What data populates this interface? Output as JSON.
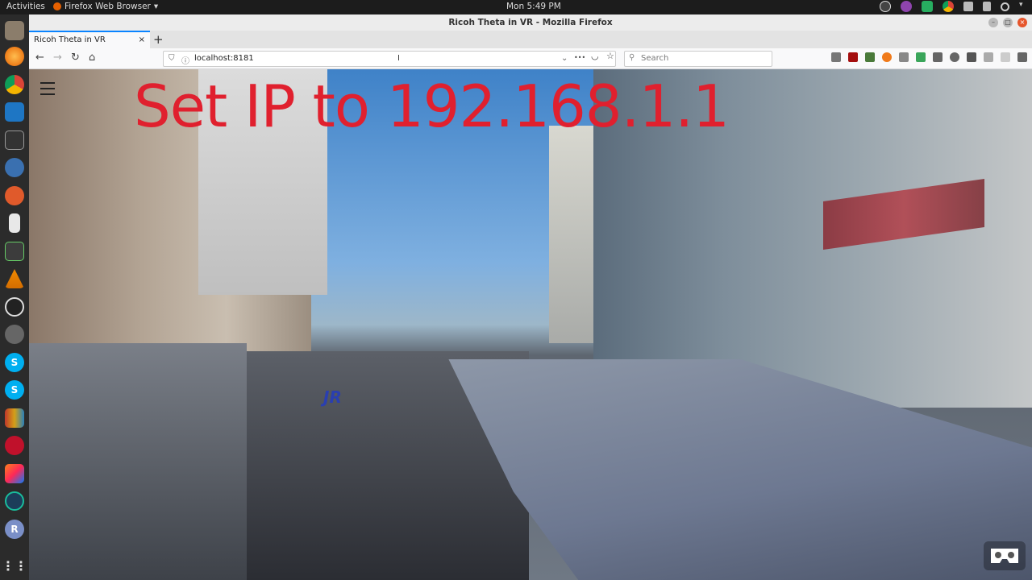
{
  "topbar": {
    "activities": "Activities",
    "app_name": "Firefox Web Browser",
    "clock": "Mon  5:49 PM"
  },
  "window": {
    "title": "Ricoh Theta in VR - Mozilla Firefox"
  },
  "tab": {
    "title": "Ricoh Theta in VR",
    "close": "×",
    "new_tab": "+"
  },
  "navbar": {
    "url": "localhost:8181",
    "search_placeholder": "Search",
    "more": "•••"
  },
  "page": {
    "overlay_text": "Set IP to 192.168.1.1",
    "sign_text": "JR"
  },
  "dock_icons": [
    "files-icon",
    "firefox-icon",
    "chrome-icon",
    "vscode-icon",
    "terminal-icon",
    "app-icon",
    "settings-icon",
    "text-editor-icon",
    "system-monitor-icon",
    "vlc-icon",
    "obs-icon",
    "app2-icon",
    "skype-icon",
    "skype2-icon",
    "books-icon",
    "cherry-icon",
    "intellij-icon",
    "app3-icon",
    "r-icon",
    "app-grid-icon"
  ],
  "colors": {
    "overlay_text": "#e0202e",
    "tab_accent": "#0a84ff"
  }
}
